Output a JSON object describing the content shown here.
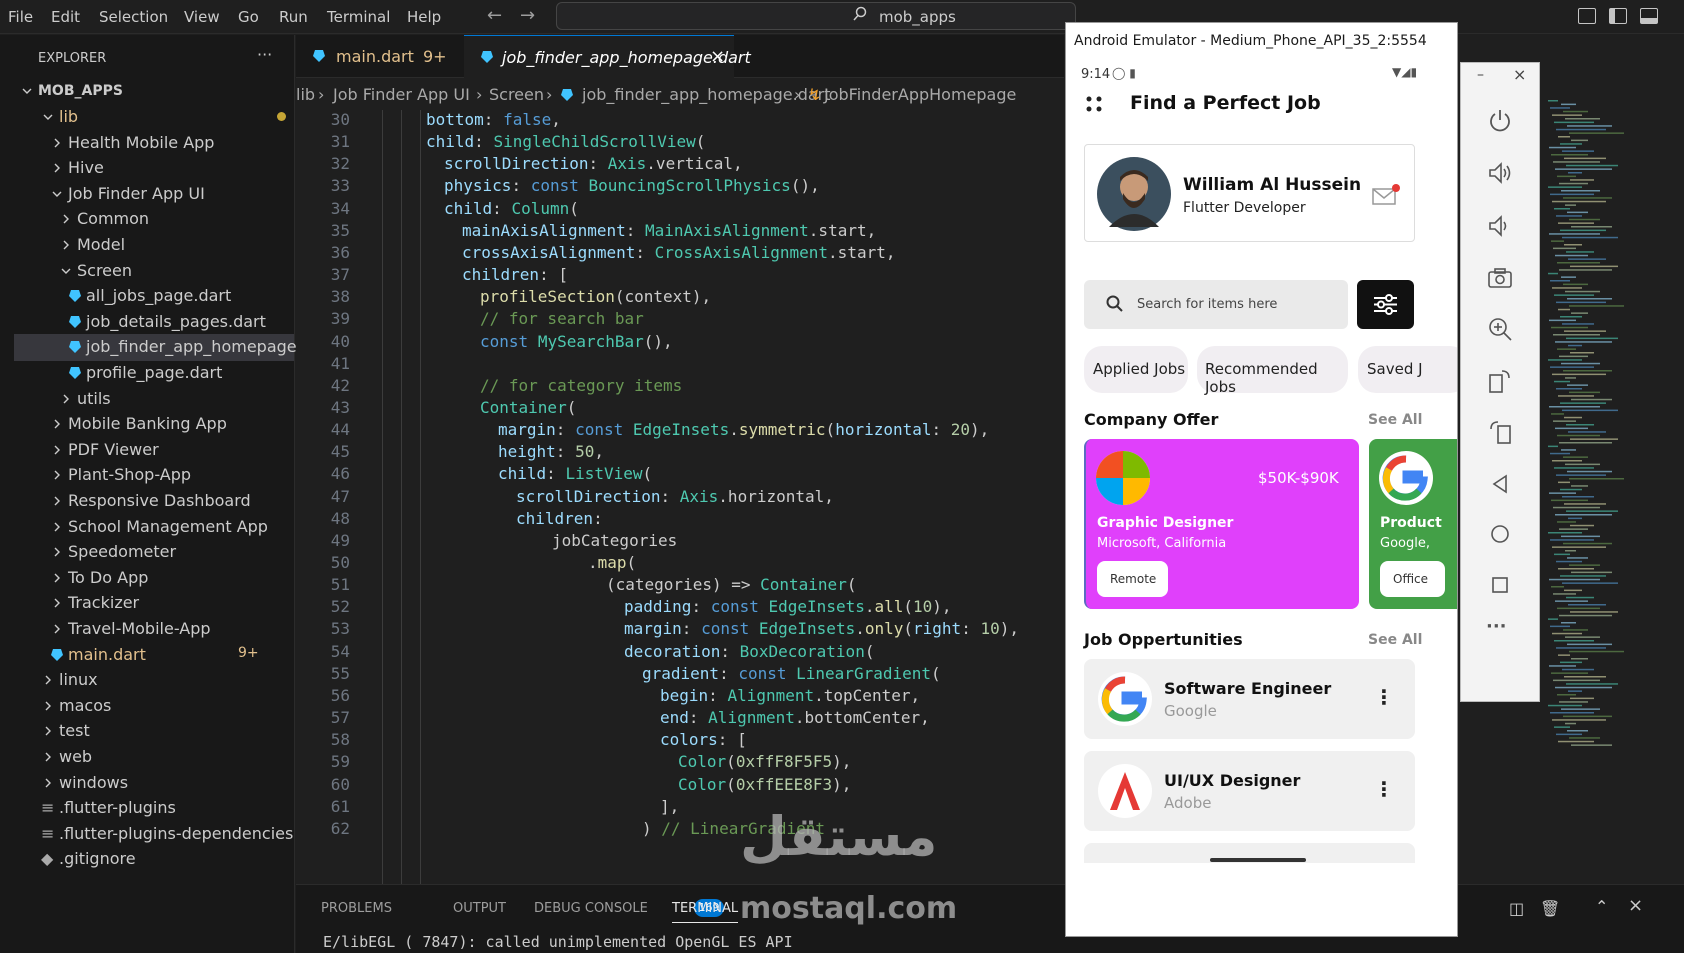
{
  "menu": [
    "File",
    "Edit",
    "Selection",
    "View",
    "Go",
    "Run",
    "Terminal",
    "Help"
  ],
  "command_center": {
    "text": "mob_apps"
  },
  "explorer": {
    "title": "EXPLORER",
    "root": "MOB_APPS",
    "items": [
      {
        "label": "lib",
        "expanded": true
      },
      {
        "label": "Health Mobile App"
      },
      {
        "label": "Hive"
      },
      {
        "label": "Job Finder App UI",
        "expanded": true
      },
      {
        "label": "Common"
      },
      {
        "label": "Model"
      },
      {
        "label": "Screen",
        "expanded": true
      },
      {
        "label": "all_jobs_page.dart"
      },
      {
        "label": "job_details_pages.dart"
      },
      {
        "label": "job_finder_app_homepage...."
      },
      {
        "label": "profile_page.dart"
      },
      {
        "label": "utils"
      },
      {
        "label": "Mobile Banking App"
      },
      {
        "label": "PDF Viewer"
      },
      {
        "label": "Plant-Shop-App"
      },
      {
        "label": "Responsive Dashboard"
      },
      {
        "label": "School Management App"
      },
      {
        "label": "Speedometer"
      },
      {
        "label": "To Do App"
      },
      {
        "label": "Trackizer"
      },
      {
        "label": "Travel-Mobile-App"
      },
      {
        "label": "main.dart",
        "badge": "9+"
      },
      {
        "label": "linux"
      },
      {
        "label": "macos"
      },
      {
        "label": "test"
      },
      {
        "label": "web"
      },
      {
        "label": "windows"
      },
      {
        "label": ".flutter-plugins"
      },
      {
        "label": ".flutter-plugins-dependencies"
      },
      {
        "label": ".gitignore"
      }
    ]
  },
  "tabs": [
    {
      "label": "main.dart",
      "badge": "9+"
    },
    {
      "label": "job_finder_app_homepage.dart"
    }
  ],
  "breadcrumb": [
    "lib",
    "Job Finder App UI",
    "Screen",
    "job_finder_app_homepage.dart",
    "JobFinderAppHomepage"
  ],
  "code_lines": [
    {
      "n": "30",
      "text": "bottom: false,"
    },
    {
      "n": "31",
      "text": "child: SingleChildScrollView("
    },
    {
      "n": "32",
      "text": "scrollDirection: Axis.vertical,"
    },
    {
      "n": "33",
      "text": "physics: const BouncingScrollPhysics(),"
    },
    {
      "n": "34",
      "text": "child: Column("
    },
    {
      "n": "35",
      "text": "mainAxisAlignment: MainAxisAlignment.start,"
    },
    {
      "n": "36",
      "text": "crossAxisAlignment: CrossAxisAlignment.start,"
    },
    {
      "n": "37",
      "text": "children: ["
    },
    {
      "n": "38",
      "text": "profileSection(context),"
    },
    {
      "n": "39",
      "text": "// for search bar"
    },
    {
      "n": "40",
      "text": "const MySearchBar(),"
    },
    {
      "n": "41",
      "text": ""
    },
    {
      "n": "42",
      "text": "// for category items"
    },
    {
      "n": "43",
      "text": "Container("
    },
    {
      "n": "44",
      "text": "margin: const EdgeInsets.symmetric(horizontal: 20),"
    },
    {
      "n": "45",
      "text": "height: 50,"
    },
    {
      "n": "46",
      "text": "child: ListView("
    },
    {
      "n": "47",
      "text": "scrollDirection: Axis.horizontal,"
    },
    {
      "n": "48",
      "text": "children:"
    },
    {
      "n": "49",
      "text": "jobCategories"
    },
    {
      "n": "50",
      "text": ".map("
    },
    {
      "n": "51",
      "text": "(categories) => Container("
    },
    {
      "n": "52",
      "text": "padding: const EdgeInsets.all(10),"
    },
    {
      "n": "53",
      "text": "margin: const EdgeInsets.only(right: 10),"
    },
    {
      "n": "54",
      "text": "decoration: BoxDecoration("
    },
    {
      "n": "55",
      "text": "gradient: const LinearGradient("
    },
    {
      "n": "56",
      "text": "begin: Alignment.topCenter,"
    },
    {
      "n": "57",
      "text": "end: Alignment.bottomCenter,"
    },
    {
      "n": "58",
      "text": "colors: ["
    },
    {
      "n": "59",
      "text": "Color(0xffF8F5F5),"
    },
    {
      "n": "60",
      "text": "Color(0xffEEE8F3),"
    },
    {
      "n": "61",
      "text": "],"
    },
    {
      "n": "62",
      "text": ") // LinearGradient"
    }
  ],
  "panel": {
    "tabs": [
      "PROBLEMS",
      "OUTPUT",
      "DEBUG CONSOLE",
      "TERMINAL"
    ],
    "problems_count": "169",
    "terminal_line": "E/libEGL  ( 7847): called unimplemented OpenGL ES API"
  },
  "emulator": {
    "title": "Android Emulator - Medium_Phone_API_35_2:5554",
    "status_time": "9:14",
    "app": {
      "title": "Find a Perfect Job",
      "profile": {
        "name": "William Al Hussein",
        "role": "Flutter Developer"
      },
      "search_placeholder": "Search for items here",
      "chips": [
        "Applied Jobs",
        "Recommended Jobs",
        "Saved J"
      ],
      "company_offer": {
        "heading": "Company Offer",
        "see_all": "See All"
      },
      "offers": [
        {
          "salary": "$50K-$90K",
          "title": "Graphic Designer",
          "company": "Microsoft, California",
          "tag": "Remote",
          "color": "#e040fb"
        },
        {
          "title": "Product",
          "company": "Google, ",
          "tag": "Office",
          "color": "#43a047"
        }
      ],
      "jobs_heading": {
        "heading": "Job Oppertunities",
        "see_all": "See All"
      },
      "jobs": [
        {
          "title": "Software Engineer",
          "company": "Google"
        },
        {
          "title": "UI/UX Designer",
          "company": "Adobe"
        }
      ]
    }
  },
  "watermark": {
    "arabic": "مستقل",
    "latin": "mostaql.com"
  }
}
